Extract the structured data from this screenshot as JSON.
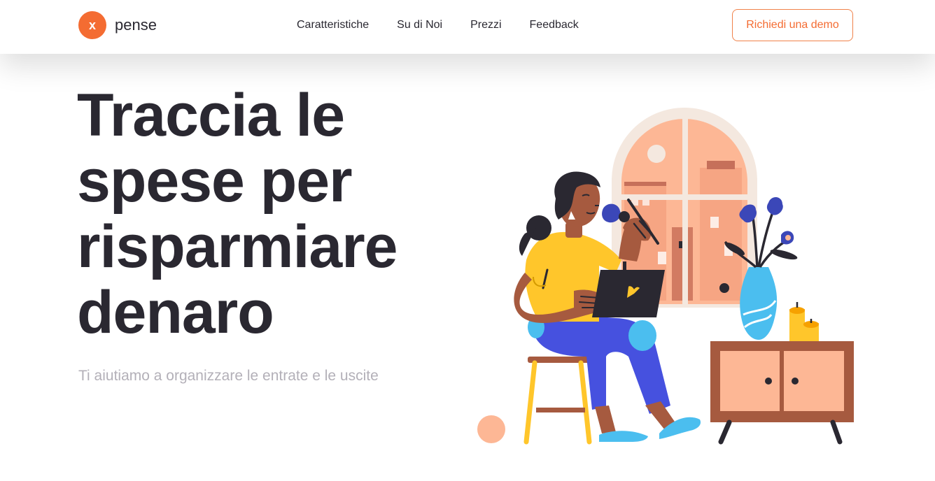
{
  "header": {
    "logo_mark": "x",
    "logo_text": "pense",
    "nav": [
      {
        "label": "Caratteristiche"
      },
      {
        "label": "Su di Noi"
      },
      {
        "label": "Prezzi"
      },
      {
        "label": "Feedback"
      }
    ],
    "cta_label": "Richiedi una demo"
  },
  "hero": {
    "title": "Traccia le spese per risparmiare denaro",
    "subtitle": "Ti aiutiamo a organizzare le entrate e le uscite"
  },
  "colors": {
    "brand_orange": "#f46c32",
    "text_dark": "#2a2831",
    "text_muted": "#b3b0b8"
  }
}
